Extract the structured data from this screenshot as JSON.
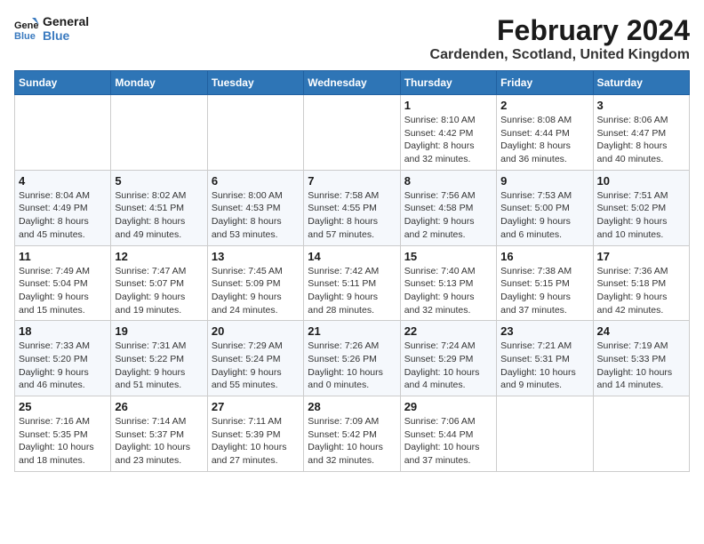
{
  "logo": {
    "line1": "General",
    "line2": "Blue"
  },
  "header": {
    "month": "February 2024",
    "location": "Cardenden, Scotland, United Kingdom"
  },
  "days_of_week": [
    "Sunday",
    "Monday",
    "Tuesday",
    "Wednesday",
    "Thursday",
    "Friday",
    "Saturday"
  ],
  "weeks": [
    [
      {
        "day": "",
        "info": ""
      },
      {
        "day": "",
        "info": ""
      },
      {
        "day": "",
        "info": ""
      },
      {
        "day": "",
        "info": ""
      },
      {
        "day": "1",
        "info": "Sunrise: 8:10 AM\nSunset: 4:42 PM\nDaylight: 8 hours\nand 32 minutes."
      },
      {
        "day": "2",
        "info": "Sunrise: 8:08 AM\nSunset: 4:44 PM\nDaylight: 8 hours\nand 36 minutes."
      },
      {
        "day": "3",
        "info": "Sunrise: 8:06 AM\nSunset: 4:47 PM\nDaylight: 8 hours\nand 40 minutes."
      }
    ],
    [
      {
        "day": "4",
        "info": "Sunrise: 8:04 AM\nSunset: 4:49 PM\nDaylight: 8 hours\nand 45 minutes."
      },
      {
        "day": "5",
        "info": "Sunrise: 8:02 AM\nSunset: 4:51 PM\nDaylight: 8 hours\nand 49 minutes."
      },
      {
        "day": "6",
        "info": "Sunrise: 8:00 AM\nSunset: 4:53 PM\nDaylight: 8 hours\nand 53 minutes."
      },
      {
        "day": "7",
        "info": "Sunrise: 7:58 AM\nSunset: 4:55 PM\nDaylight: 8 hours\nand 57 minutes."
      },
      {
        "day": "8",
        "info": "Sunrise: 7:56 AM\nSunset: 4:58 PM\nDaylight: 9 hours\nand 2 minutes."
      },
      {
        "day": "9",
        "info": "Sunrise: 7:53 AM\nSunset: 5:00 PM\nDaylight: 9 hours\nand 6 minutes."
      },
      {
        "day": "10",
        "info": "Sunrise: 7:51 AM\nSunset: 5:02 PM\nDaylight: 9 hours\nand 10 minutes."
      }
    ],
    [
      {
        "day": "11",
        "info": "Sunrise: 7:49 AM\nSunset: 5:04 PM\nDaylight: 9 hours\nand 15 minutes."
      },
      {
        "day": "12",
        "info": "Sunrise: 7:47 AM\nSunset: 5:07 PM\nDaylight: 9 hours\nand 19 minutes."
      },
      {
        "day": "13",
        "info": "Sunrise: 7:45 AM\nSunset: 5:09 PM\nDaylight: 9 hours\nand 24 minutes."
      },
      {
        "day": "14",
        "info": "Sunrise: 7:42 AM\nSunset: 5:11 PM\nDaylight: 9 hours\nand 28 minutes."
      },
      {
        "day": "15",
        "info": "Sunrise: 7:40 AM\nSunset: 5:13 PM\nDaylight: 9 hours\nand 32 minutes."
      },
      {
        "day": "16",
        "info": "Sunrise: 7:38 AM\nSunset: 5:15 PM\nDaylight: 9 hours\nand 37 minutes."
      },
      {
        "day": "17",
        "info": "Sunrise: 7:36 AM\nSunset: 5:18 PM\nDaylight: 9 hours\nand 42 minutes."
      }
    ],
    [
      {
        "day": "18",
        "info": "Sunrise: 7:33 AM\nSunset: 5:20 PM\nDaylight: 9 hours\nand 46 minutes."
      },
      {
        "day": "19",
        "info": "Sunrise: 7:31 AM\nSunset: 5:22 PM\nDaylight: 9 hours\nand 51 minutes."
      },
      {
        "day": "20",
        "info": "Sunrise: 7:29 AM\nSunset: 5:24 PM\nDaylight: 9 hours\nand 55 minutes."
      },
      {
        "day": "21",
        "info": "Sunrise: 7:26 AM\nSunset: 5:26 PM\nDaylight: 10 hours\nand 0 minutes."
      },
      {
        "day": "22",
        "info": "Sunrise: 7:24 AM\nSunset: 5:29 PM\nDaylight: 10 hours\nand 4 minutes."
      },
      {
        "day": "23",
        "info": "Sunrise: 7:21 AM\nSunset: 5:31 PM\nDaylight: 10 hours\nand 9 minutes."
      },
      {
        "day": "24",
        "info": "Sunrise: 7:19 AM\nSunset: 5:33 PM\nDaylight: 10 hours\nand 14 minutes."
      }
    ],
    [
      {
        "day": "25",
        "info": "Sunrise: 7:16 AM\nSunset: 5:35 PM\nDaylight: 10 hours\nand 18 minutes."
      },
      {
        "day": "26",
        "info": "Sunrise: 7:14 AM\nSunset: 5:37 PM\nDaylight: 10 hours\nand 23 minutes."
      },
      {
        "day": "27",
        "info": "Sunrise: 7:11 AM\nSunset: 5:39 PM\nDaylight: 10 hours\nand 27 minutes."
      },
      {
        "day": "28",
        "info": "Sunrise: 7:09 AM\nSunset: 5:42 PM\nDaylight: 10 hours\nand 32 minutes."
      },
      {
        "day": "29",
        "info": "Sunrise: 7:06 AM\nSunset: 5:44 PM\nDaylight: 10 hours\nand 37 minutes."
      },
      {
        "day": "",
        "info": ""
      },
      {
        "day": "",
        "info": ""
      }
    ]
  ]
}
